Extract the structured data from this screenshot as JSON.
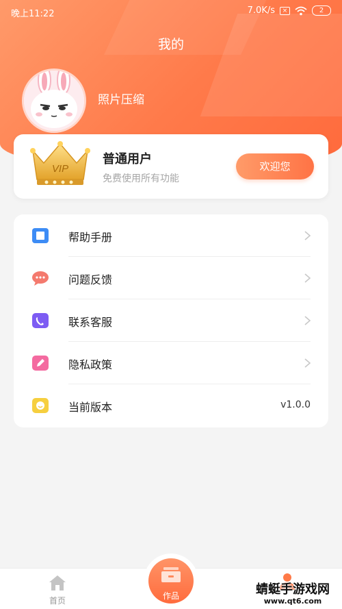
{
  "status_bar": {
    "time": "晚上11:22",
    "network_speed": "7.0K/s",
    "battery": "2"
  },
  "header": {
    "title": "我的",
    "username": "照片压缩"
  },
  "vip_card": {
    "crown_text": "VIP",
    "title": "普通用户",
    "subtitle": "免费使用所有功能",
    "button": "欢迎您"
  },
  "menu": {
    "items": [
      {
        "label": "帮助手册",
        "icon": "book-icon",
        "color": "#3d8cf5"
      },
      {
        "label": "问题反馈",
        "icon": "chat-bubble-icon",
        "color": "#f47a6e"
      },
      {
        "label": "联系客服",
        "icon": "phone-icon",
        "color": "#7d5cf3"
      },
      {
        "label": "隐私政策",
        "icon": "pencil-icon",
        "color": "#f46aa0"
      },
      {
        "label": "当前版本",
        "icon": "smiley-icon",
        "color": "#f6cf3f",
        "value": "v1.0.0"
      }
    ]
  },
  "tab_bar": {
    "home": "首页",
    "works": "作品",
    "mine": ""
  },
  "watermark": {
    "title": "蜻蜓手游戏网",
    "url": "www.qt6.com"
  },
  "colors": {
    "accent": "#ff7a4a",
    "background": "#f4f4f4"
  }
}
